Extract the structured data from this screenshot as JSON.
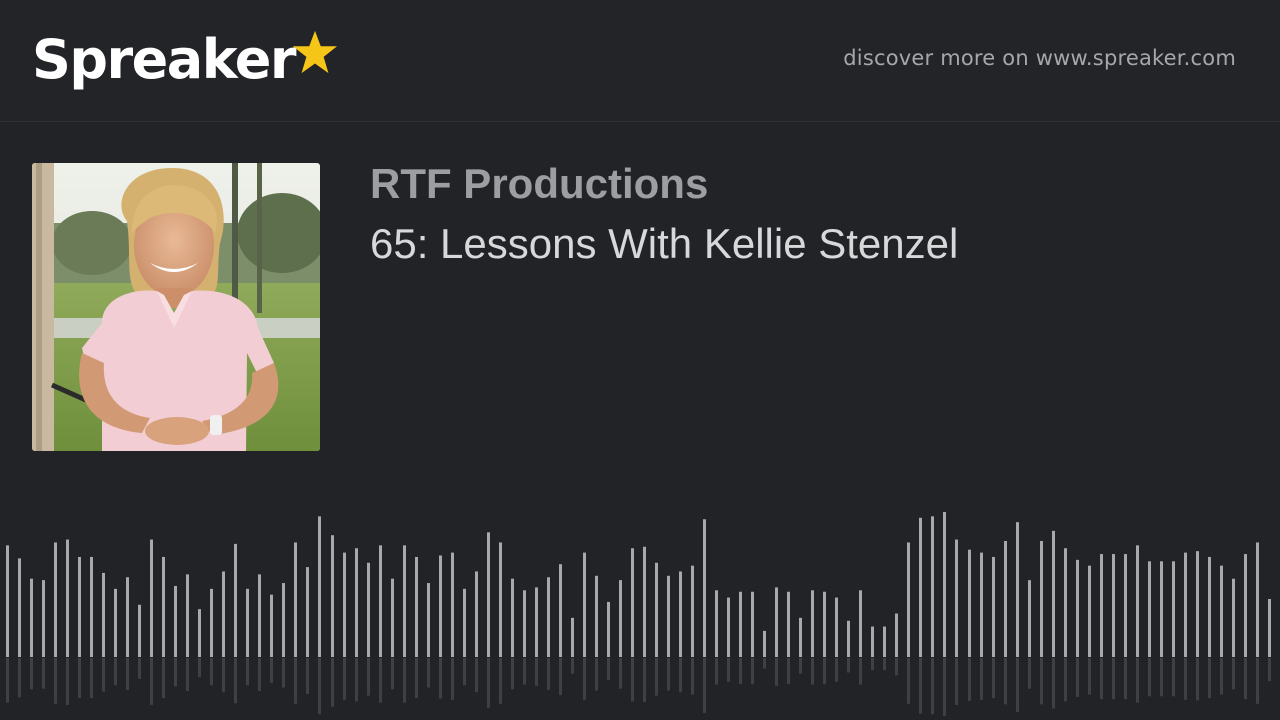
{
  "header": {
    "logo_text": "Spreaker",
    "logo_star_color": "#f5c518",
    "discover_text": "discover more on www.spreaker.com"
  },
  "episode": {
    "show_name": "RTF Productions",
    "title": "65: Lessons With Kellie Stenzel",
    "cover_alt": "Photo of woman in pink polo shirt on golf course"
  },
  "waveform": {
    "bar_color": "#a9a9ab",
    "levels": [
      0.77,
      0.68,
      0.54,
      0.53,
      0.79,
      0.81,
      0.69,
      0.69,
      0.58,
      0.47,
      0.55,
      0.36,
      0.81,
      0.69,
      0.49,
      0.57,
      0.33,
      0.47,
      0.59,
      0.78,
      0.47,
      0.57,
      0.43,
      0.51,
      0.79,
      0.62,
      0.97,
      0.84,
      0.72,
      0.75,
      0.65,
      0.77,
      0.54,
      0.77,
      0.69,
      0.51,
      0.7,
      0.72,
      0.47,
      0.59,
      0.86,
      0.79,
      0.54,
      0.46,
      0.48,
      0.55,
      0.64,
      0.27,
      0.72,
      0.56,
      0.38,
      0.53,
      0.75,
      0.76,
      0.65,
      0.56,
      0.59,
      0.63,
      0.95,
      0.46,
      0.41,
      0.45,
      0.45,
      0.18,
      0.48,
      0.45,
      0.27,
      0.46,
      0.45,
      0.41,
      0.25,
      0.46,
      0.21,
      0.21,
      0.3,
      0.79,
      0.96,
      0.97,
      1.0,
      0.81,
      0.74,
      0.72,
      0.69,
      0.8,
      0.93,
      0.53,
      0.8,
      0.87,
      0.75,
      0.67,
      0.63,
      0.71,
      0.71,
      0.71,
      0.77,
      0.66,
      0.66,
      0.66,
      0.72,
      0.73,
      0.69,
      0.63,
      0.54,
      0.71,
      0.79,
      0.4
    ]
  }
}
